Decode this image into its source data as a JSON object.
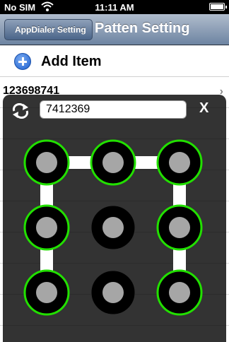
{
  "status_bar": {
    "carrier": "No SIM",
    "time": "11:11 AM"
  },
  "nav": {
    "back_label": "AppDialer Setting",
    "title": "Patten Setting"
  },
  "list": {
    "add_item_label": "Add Item",
    "entry_name": "123698741",
    "chevron": "›"
  },
  "pattern_dialog": {
    "input_value": "7412369",
    "close_label": "X",
    "selected_color": "#22e000",
    "dots": [
      {
        "id": 1,
        "selected": true
      },
      {
        "id": 2,
        "selected": true
      },
      {
        "id": 3,
        "selected": true
      },
      {
        "id": 4,
        "selected": true
      },
      {
        "id": 5,
        "selected": false
      },
      {
        "id": 6,
        "selected": true
      },
      {
        "id": 7,
        "selected": true
      },
      {
        "id": 8,
        "selected": false
      },
      {
        "id": 9,
        "selected": true
      }
    ],
    "path_sequence": [
      7,
      4,
      1,
      2,
      3,
      6,
      9
    ]
  }
}
